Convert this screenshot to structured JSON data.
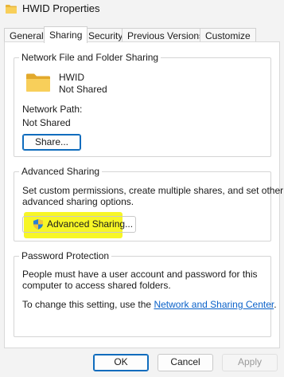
{
  "window": {
    "title": "HWID Properties",
    "icon": "folder-icon"
  },
  "tabs": [
    {
      "label": "General",
      "active": false
    },
    {
      "label": "Sharing",
      "active": true
    },
    {
      "label": "Security",
      "active": false
    },
    {
      "label": "Previous Versions",
      "active": false
    },
    {
      "label": "Customize",
      "active": false
    }
  ],
  "network_sharing": {
    "legend": "Network File and Folder Sharing",
    "folder_name": "HWID",
    "folder_status": "Not Shared",
    "path_label": "Network Path:",
    "path_value": "Not Shared",
    "share_button": "Share..."
  },
  "advanced_sharing": {
    "legend": "Advanced Sharing",
    "description_line1": "Set custom permissions, create multiple shares, and set other",
    "description_line2": "advanced sharing options.",
    "button": "Advanced Sharing...",
    "highlight_color": "#f6f400"
  },
  "password_protection": {
    "legend": "Password Protection",
    "description_line1": "People must have a user account and password for this",
    "description_line2": "computer to access shared folders.",
    "change_text": "To change this setting, use the ",
    "link_text": "Network and Sharing Center",
    "change_suffix": "."
  },
  "footer": {
    "ok": "OK",
    "cancel": "Cancel",
    "apply": "Apply"
  },
  "colors": {
    "accent": "#0f6cbd",
    "link": "#0a61c9",
    "folder": "#f5c542"
  }
}
